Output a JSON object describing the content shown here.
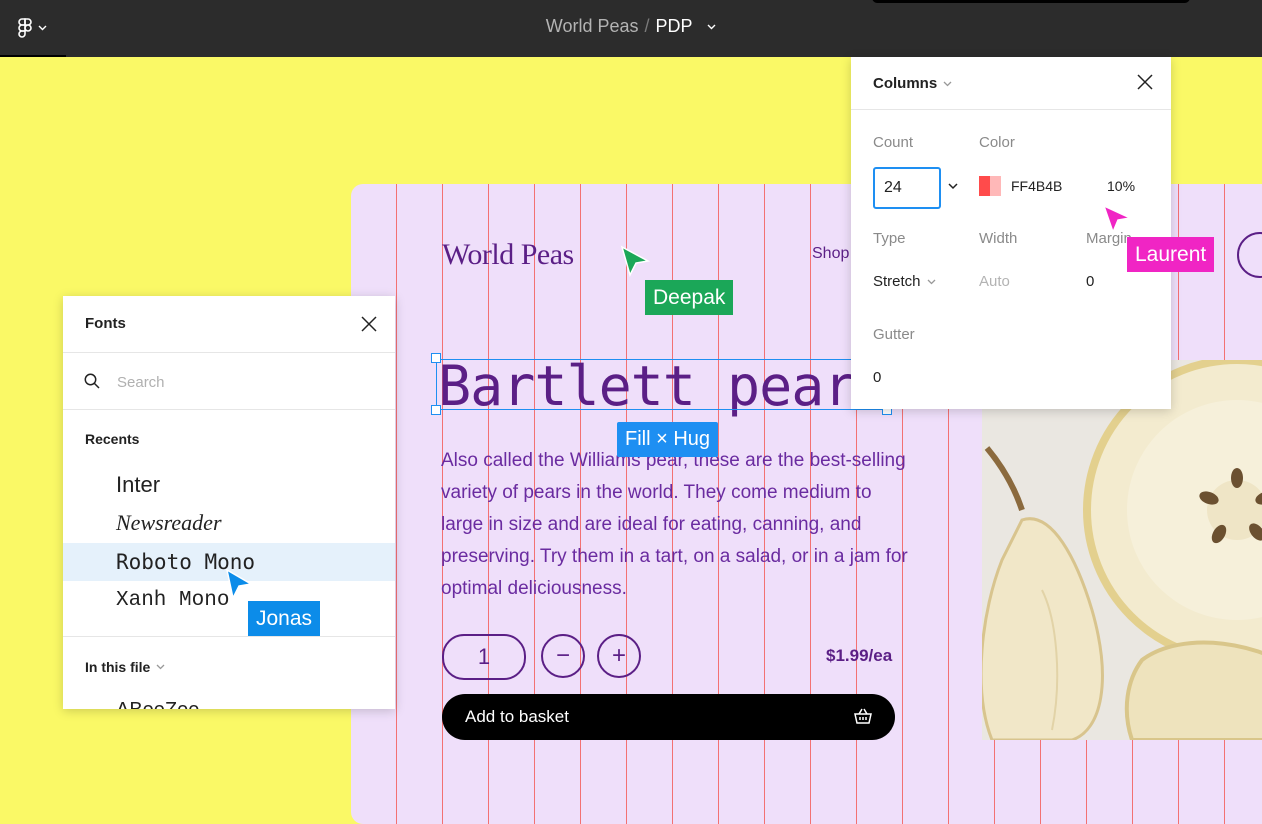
{
  "topbar": {
    "project": "World Peas",
    "separator": "/",
    "page": "PDP"
  },
  "frame": {
    "brand": "World Peas",
    "nav_shop": "Shop",
    "heading": "Bartlett pear",
    "description": "Also called the Williams pear, these are the best-selling variety of pears in the world. They come medium to large in size and are ideal for eating, canning, and preserving. Try them in a tart, on a salad, or in a jam for optimal deliciousness.",
    "quantity": "1",
    "decrement": "−",
    "increment": "+",
    "price": "$1.99/ea",
    "add_to_basket": "Add to basket",
    "grid_color": "#F26A6A",
    "bg_color": "#EFDFFA",
    "accent": "#5B1F86"
  },
  "selection": {
    "sizing_label": "Fill × Hug"
  },
  "fonts_panel": {
    "title": "Fonts",
    "search_placeholder": "Search",
    "recents_label": "Recents",
    "recents": [
      "Inter",
      "Newsreader",
      "Roboto Mono",
      "Xanh Mono"
    ],
    "selected_font": "Roboto Mono",
    "in_this_file_label": "In this file",
    "in_this_file": [
      "ABeeZee"
    ]
  },
  "columns_panel": {
    "title": "Columns",
    "count_label": "Count",
    "count_value": "24",
    "color_label": "Color",
    "color_hex": "FF4B4B",
    "color_swatch": "#FF4B4B",
    "opacity": "10%",
    "type_label": "Type",
    "type_value": "Stretch",
    "width_label": "Width",
    "width_value": "Auto",
    "margin_label": "Margin",
    "margin_value": "0",
    "gutter_label": "Gutter",
    "gutter_value": "0"
  },
  "collaborators": [
    {
      "name": "Deepak",
      "color": "#1BA758"
    },
    {
      "name": "Laurent",
      "color": "#F025C4"
    },
    {
      "name": "Jonas",
      "color": "#0C8CE9"
    }
  ]
}
